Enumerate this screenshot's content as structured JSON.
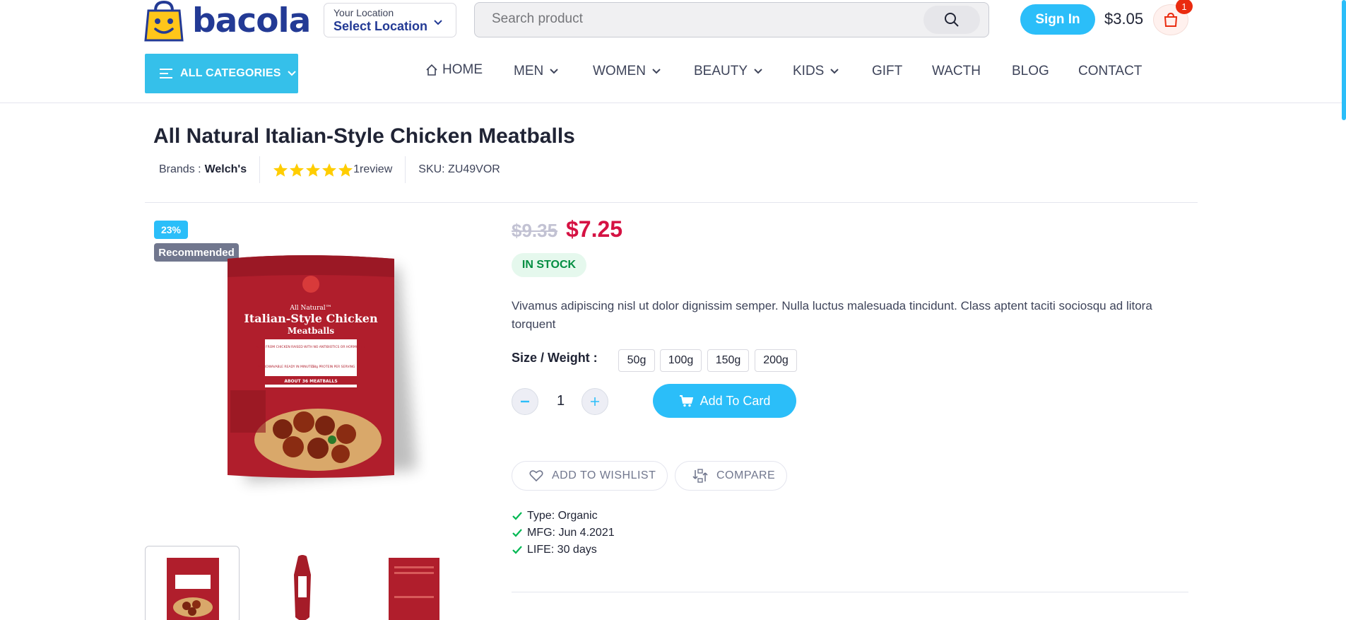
{
  "header": {
    "logo_text": "bacola",
    "location_label": "Your Location",
    "location_value": "Select Location",
    "search_placeholder": "Search product",
    "signin_label": "Sign In",
    "cart_total": "$3.05",
    "cart_count": "1",
    "all_categories_label": "ALL CATEGORIES"
  },
  "nav": {
    "items": [
      {
        "label": "HOME",
        "icon": "home-icon"
      },
      {
        "label": "MEN",
        "icon": "chevron-down-icon"
      },
      {
        "label": "WOMEN",
        "icon": "chevron-down-icon"
      },
      {
        "label": "BEAUTY",
        "icon": "chevron-down-icon"
      },
      {
        "label": "KIDS",
        "icon": "chevron-down-icon"
      },
      {
        "label": "GIFT"
      },
      {
        "label": "WACTH"
      },
      {
        "label": "BLOG"
      },
      {
        "label": "CONTACT"
      }
    ]
  },
  "product": {
    "title": "All Natural Italian-Style Chicken Meatballs",
    "brand_label": "Brands :",
    "brand_value": "Welch's",
    "rating_stars": 5,
    "review_text": "1review",
    "sku_text": "SKU: ZU49VOR",
    "discount_badge": "23%",
    "recommended_badge": "Recommended",
    "old_price": "$9.35",
    "new_price": "$7.25",
    "stock_status": "IN STOCK",
    "description": "Vivamus adipiscing nisl ut dolor dignissim semper. Nulla luctus malesuada tincidunt. Class aptent taciti sociosqu ad litora torquent",
    "size_label": "Size / Weight :",
    "sizes": [
      "50g",
      "100g",
      "150g",
      "200g"
    ],
    "quantity": "1",
    "add_to_cart_label": "Add To Card",
    "wishlist_label": "ADD TO WISHLIST",
    "compare_label": "COMPARE",
    "attributes": [
      "Type: Organic",
      "MFG: Jun 4.2021",
      "LIFE: 30 days"
    ],
    "package": {
      "sub": "All Natural™",
      "name": "Italian-Style Chicken",
      "name2": "Meatballs",
      "note": "MADE FROM CHICKEN RAISED WITH NO ANTIBIOTICS OR HORMONES*",
      "ready": "MICROWAVABLE READY IN MINUTES",
      "protein": "14g PROTEIN PER SERVING",
      "count": "ABOUT 36 MEATBALLS"
    }
  },
  "colors": {
    "brand_blue": "#233a95",
    "accent": "#2bbef9",
    "price_red": "#d51243",
    "stock_green": "#038e42",
    "star": "#ffcd00"
  }
}
